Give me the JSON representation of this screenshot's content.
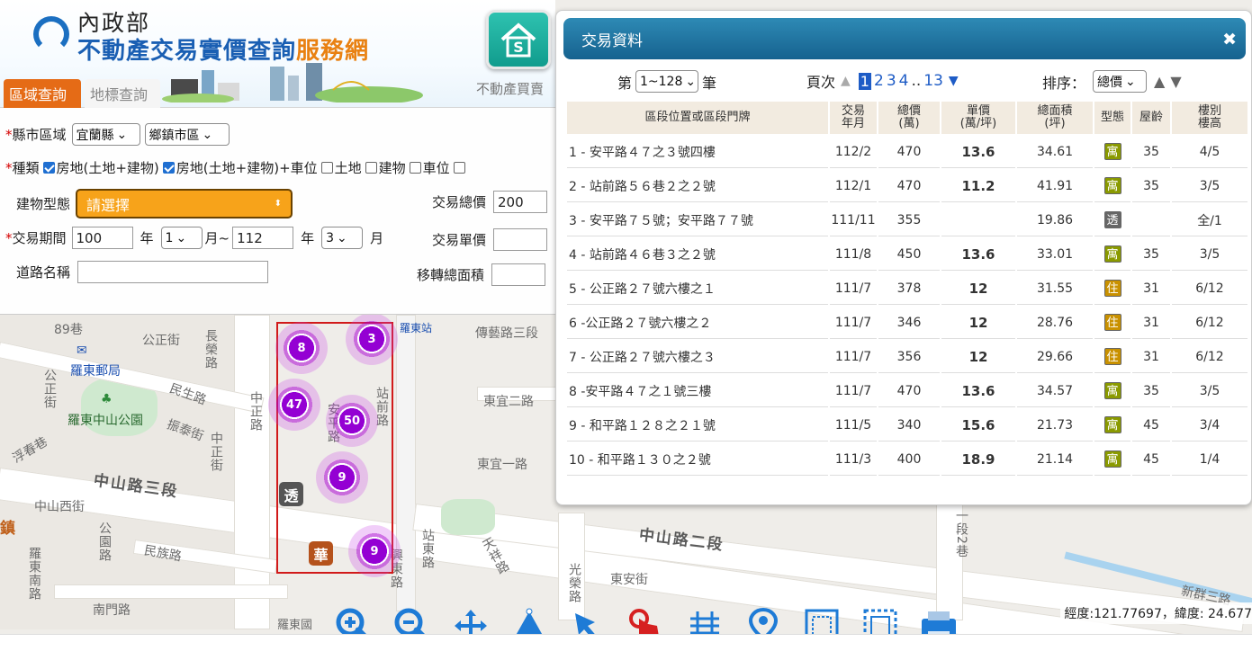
{
  "header": {
    "ministry": "內政部",
    "brand_main": "不動產交易實價查詢",
    "brand_accent": "服務網",
    "app_label": "不動產買賣",
    "tabs": [
      {
        "label": "區域查詢",
        "active": true
      },
      {
        "label": "地標查詢",
        "active": false
      }
    ]
  },
  "form": {
    "region_label": "縣市區域",
    "county": "宜蘭縣",
    "district": "鄉鎮市區",
    "type_label": "種類",
    "types": [
      {
        "label": "房地(土地+建物)",
        "checked": true
      },
      {
        "label": "房地(土地+建物)+車位",
        "checked": true
      },
      {
        "label": "土地",
        "checked": false
      },
      {
        "label": "建物",
        "checked": false
      },
      {
        "label": "車位",
        "checked": false
      }
    ],
    "building_type_label": "建物型態",
    "building_type_value": "請選擇",
    "total_price_label": "交易總價",
    "total_price_value": "200",
    "period_label": "交易期間",
    "year_from": "100",
    "month_from": "1",
    "year_to": "112",
    "month_to": "3",
    "year_unit": "年",
    "month_unit_to": "月~",
    "month_unit": "月",
    "unit_price_label": "交易單價",
    "road_label": "道路名稱",
    "area_label": "移轉總面積"
  },
  "panel": {
    "title": "交易資料",
    "range_prefix": "第",
    "range_value": "1~128",
    "range_suffix": "筆",
    "page_label": "頁次",
    "pages": [
      "1",
      "2",
      "3",
      "4",
      "..",
      "13"
    ],
    "sort_label": "排序：",
    "sort_value": "總價",
    "columns": [
      "區段位置或區段門牌",
      "交易\n年月",
      "總價\n(萬)",
      "單價\n(萬/坪)",
      "總面積\n(坪)",
      "型態",
      "屋齡",
      "樓別\n樓高"
    ],
    "rows": [
      {
        "addr": "1 - 安平路４７之３號四樓",
        "date": "112/2",
        "total": "470",
        "unit": "13.6",
        "area": "34.61",
        "type": "寓",
        "type_color": "#8a9a00",
        "age": "35",
        "floor": "4/5"
      },
      {
        "addr": "2 - 站前路５６巷２之２號",
        "date": "112/1",
        "total": "470",
        "unit": "11.2",
        "area": "41.91",
        "type": "寓",
        "type_color": "#8a9a00",
        "age": "35",
        "floor": "3/5"
      },
      {
        "addr": "3 - 安平路７５號；安平路７７號",
        "date": "111/11",
        "total": "355",
        "unit": "",
        "area": "19.86",
        "type": "透",
        "type_color": "#666666",
        "age": "",
        "floor": "全/1"
      },
      {
        "addr": "4 - 站前路４６巷３之２號",
        "date": "111/8",
        "total": "450",
        "unit": "13.6",
        "area": "33.01",
        "type": "寓",
        "type_color": "#8a9a00",
        "age": "35",
        "floor": "3/5"
      },
      {
        "addr": "5 - 公正路２７號六樓之１",
        "date": "111/7",
        "total": "378",
        "unit": "12",
        "area": "31.55",
        "type": "住",
        "type_color": "#c99100",
        "age": "31",
        "floor": "6/12"
      },
      {
        "addr": "6 -公正路２７號六樓之２",
        "date": "111/7",
        "total": "346",
        "unit": "12",
        "area": "28.76",
        "type": "住",
        "type_color": "#c99100",
        "age": "31",
        "floor": "6/12"
      },
      {
        "addr": "7 - 公正路２７號六樓之３",
        "date": "111/7",
        "total": "356",
        "unit": "12",
        "area": "29.66",
        "type": "住",
        "type_color": "#c99100",
        "age": "31",
        "floor": "6/12"
      },
      {
        "addr": "8 -安平路４７之１號三樓",
        "date": "111/7",
        "total": "470",
        "unit": "13.6",
        "area": "34.57",
        "type": "寓",
        "type_color": "#8a9a00",
        "age": "35",
        "floor": "3/5"
      },
      {
        "addr": "9 - 和平路１２８之２１號",
        "date": "111/5",
        "total": "340",
        "unit": "15.6",
        "area": "21.73",
        "type": "寓",
        "type_color": "#8a9a00",
        "age": "45",
        "floor": "3/4"
      },
      {
        "addr": "10 - 和平路１３０之２號",
        "date": "111/3",
        "total": "400",
        "unit": "18.9",
        "area": "21.14",
        "type": "寓",
        "type_color": "#8a9a00",
        "age": "45",
        "floor": "1/4"
      }
    ]
  },
  "map": {
    "clusters": [
      "8",
      "3",
      "47",
      "50",
      "9",
      "9"
    ],
    "marker_tou": "透",
    "marker_hua": "華",
    "labels": {
      "gongzheng": "公正街",
      "changxing": "長榮路",
      "post": "羅東郵局",
      "minsheng": "民生路",
      "park": "羅東中山公園",
      "zhentai": "振泰街",
      "zhongshan3": "中山路三段",
      "zhongzheng": "中正路",
      "zhongzhengst": "中正街",
      "zhongshanw": "中山西街",
      "gongyuan": "公園路",
      "minzu": "民族路",
      "nanmen": "南門路",
      "dongnan": "羅東南路",
      "fuchun": "浮春巷",
      "xingdong": "興東路",
      "chuanyi": "傳藝路三段",
      "dongyi2": "東宜二路",
      "dongyi1": "東宜一路",
      "zhongshan2": "中山路二段",
      "zhandong": "站東路",
      "tianxiang": "天祥路",
      "dongan": "東安街",
      "guangrong": "光榮路",
      "xinqun": "新群三路",
      "station": "羅東站",
      "zhanqian": "站前路",
      "anping": "安平路",
      "duan2": "一段2巷",
      "num89": "89巷",
      "zhen": "鎮",
      "luodongchurch": "羅東國"
    }
  },
  "footer": {
    "coords": "經度:121.77697，緯度: 24.677"
  },
  "colors": {
    "accent": "#e56b16",
    "brand_blue": "#1a5fb3",
    "panel_header": "#1f74a3",
    "cluster_purple": "#9400d3",
    "box_red": "#d11a1a"
  },
  "icons": [
    "zoom-in-icon",
    "zoom-out-icon",
    "pan-icon",
    "polygon-icon",
    "pointer-icon",
    "hand-pointer-icon",
    "grid-icon",
    "location-pin-icon",
    "select-box-icon",
    "select-rect-icon",
    "print-icon"
  ]
}
